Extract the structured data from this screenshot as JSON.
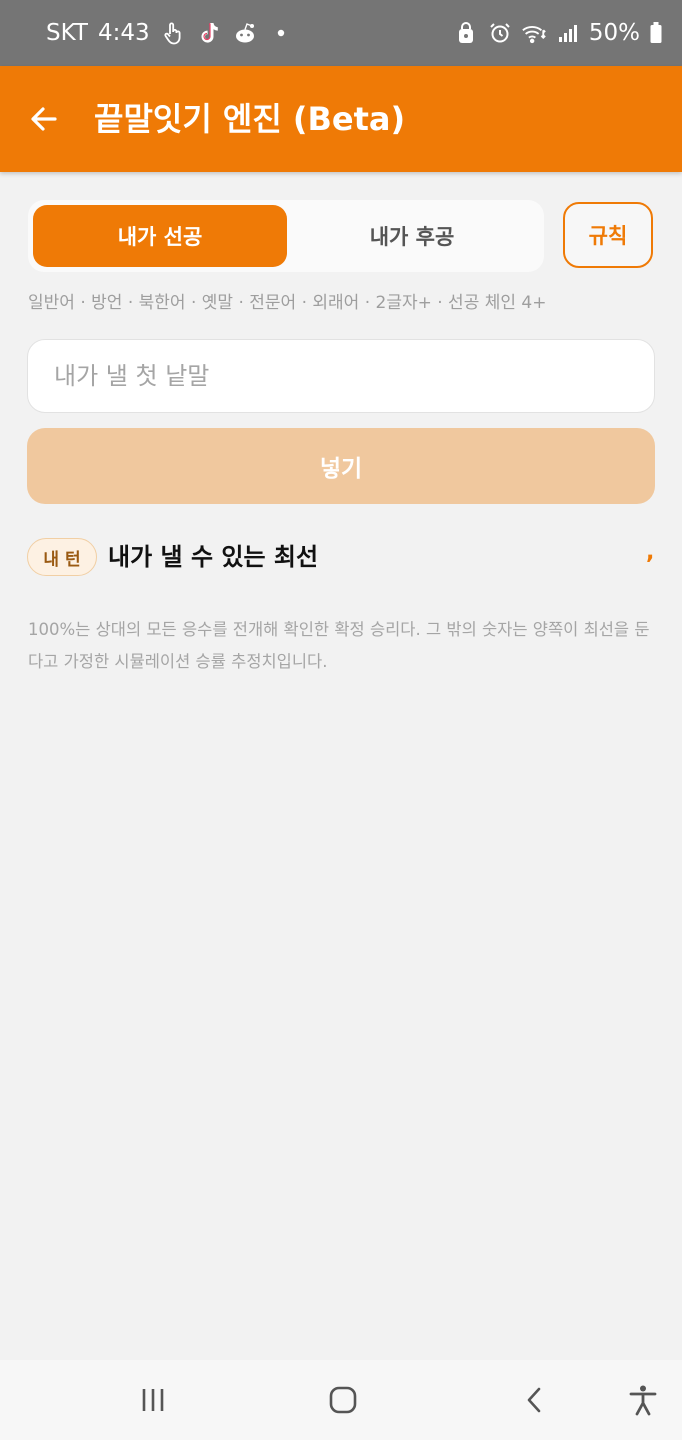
{
  "status_bar": {
    "carrier": "SKT",
    "time": "4:43",
    "battery": "50%",
    "icons_left": [
      "touch-icon",
      "tiktok-icon",
      "reddit-icon",
      "dot-icon"
    ],
    "icons_right": [
      "vpn-lock-icon",
      "alarm-icon",
      "wifi-icon",
      "signal-icon",
      "battery-icon"
    ]
  },
  "app_bar": {
    "title": "끝말잇기 엔진 (Beta)",
    "back_icon": "arrow-left-icon"
  },
  "order_toggle": {
    "options": [
      "내가 선공",
      "내가 후공"
    ],
    "selected_index": 0
  },
  "rules_button": {
    "label": "규칙"
  },
  "filters": {
    "text": "일반어 · 방언 · 북한어 · 옛말 · 전문어 · 외래어 · 2글자+ · 선공 체인 4+"
  },
  "first_word_input": {
    "value": "",
    "placeholder": "내가 낼 첫 낱말"
  },
  "submit_button": {
    "label": "넣기"
  },
  "section": {
    "badge": "내 턴",
    "title": "내가 낼 수 있는 최선",
    "mark": ","
  },
  "note": {
    "text": "100%는 상대의 모든 응수를 전개해 확인한 확정 승리다. 그 밖의 숫자는 양쪽이 최선을 둔다고 가정한 시뮬레이션 승률 추정치입니다."
  },
  "colors": {
    "accent": "#ef7a06",
    "accent_disabled": "#f0c89e",
    "status_bar": "#757575",
    "background": "#f2f2f2"
  },
  "nav_bar": {
    "icons": [
      "recent-apps-icon",
      "home-icon",
      "back-icon",
      "accessibility-icon"
    ]
  }
}
